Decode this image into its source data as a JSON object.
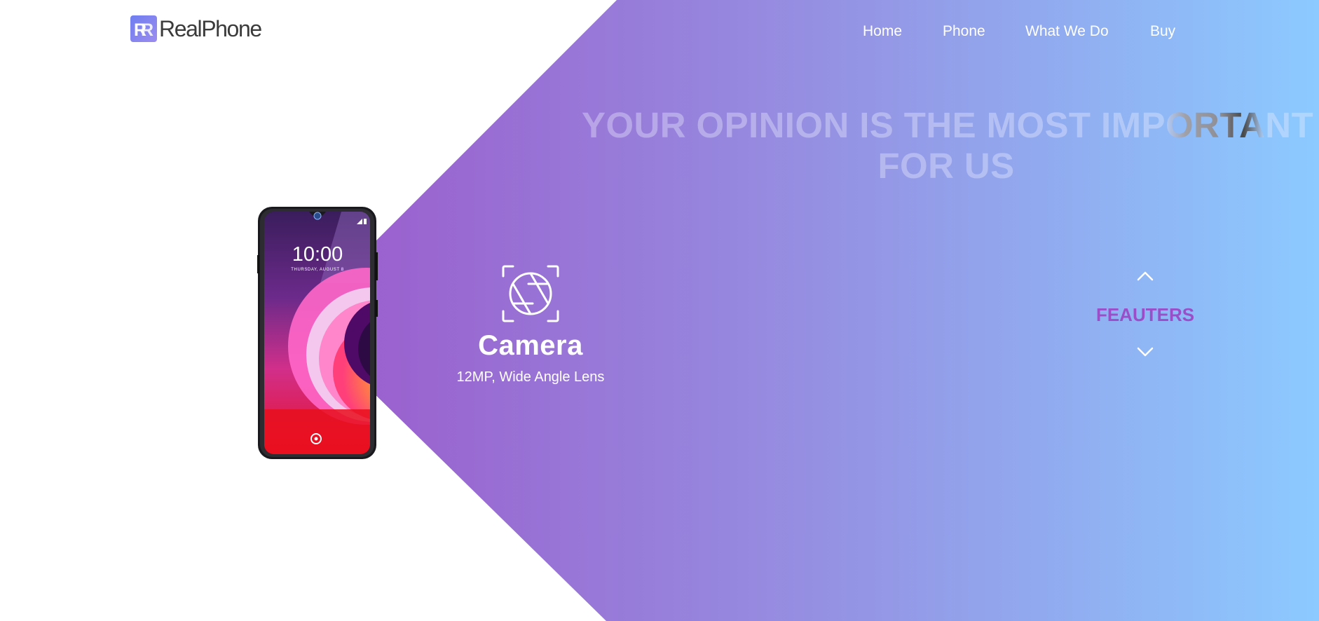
{
  "brand": {
    "name": "RealPhone",
    "logo_icon": "rr-monogram-logo-icon",
    "accent_color": "#7a83ee"
  },
  "nav": {
    "items": [
      {
        "label": "Home"
      },
      {
        "label": "Phone"
      },
      {
        "label": "What We Do"
      },
      {
        "label": "Buy"
      }
    ]
  },
  "hero": {
    "headline_line1_a": "YOUR OPINION IS THE MOST IMP",
    "headline_line1_b": "ORTA",
    "headline_line1_c": "NT",
    "headline_line2": "FOR US",
    "background_gradient": [
      "#9b59c8",
      "#9590e2",
      "#8ccaff"
    ]
  },
  "phone": {
    "clock": "10:00",
    "date": "THURSDAY, AUGUST 8",
    "image_icon": "smartphone-product-image"
  },
  "feature": {
    "icon": "camera-aperture-icon",
    "title": "Camera",
    "description": "12MP, Wide Angle Lens"
  },
  "switcher": {
    "label": "FEAUTERS",
    "up_icon": "chevron-up-icon",
    "down_icon": "chevron-down-icon",
    "label_color": "#9a4fc9"
  }
}
